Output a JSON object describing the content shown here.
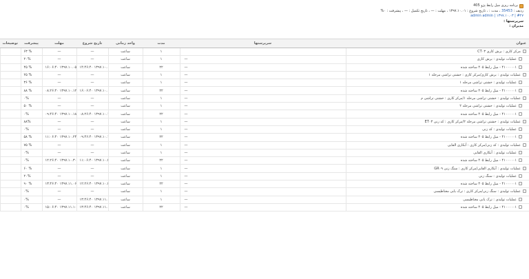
{
  "header": {
    "title": "برنامه ریزی میل رابط پژو 405",
    "meta_prefix": "ردیف :",
    "meta_id": "35453",
    "meta_rest": "، مدت : ، تاریخ شروع : ۱۳۹۷.۱۰.۰۱ ، مهلت : — ، تاریخ تکمیل : — ، پیشرفت : ۰%",
    "meta_line2": "#۲۷ | ۱۳۹۷.۱۰.۰۳ | admin admin",
    "supervisors_label": "سرپرستها :",
    "managers_label": "مدیران :"
  },
  "columns": {
    "title": "عنوان",
    "supervisors": "سرپرستها",
    "duration": "مدت",
    "unit": "واحد زمانی",
    "start": "تاریخ شروع",
    "deadline": "مهلت",
    "progress": "پیشرفت",
    "notes": "توضیحات"
  },
  "rows": [
    {
      "title": "مرکز کاری : برش کاری CT۰۳",
      "res": "",
      "dur": "۱",
      "unit": "ساعت",
      "start": "—",
      "deadline": "—",
      "prog": "۶۳ %",
      "level": 1
    },
    {
      "title": "عملیات تولیدی : برش کاری",
      "res": "—",
      "dur": "۱",
      "unit": "ساعت",
      "start": "—",
      "deadline": "—",
      "prog": "۲۰%",
      "level": 2
    },
    {
      "title": "۴۱۰۰۰۰۰۱ - میل رابط ۴۰۵ ساخته شده",
      "res": "—",
      "dur": "۲۲",
      "unit": "ساعت",
      "start": "۱۴:۴۶:۴۰ ۱۳۹۷.۱۰.۰۱",
      "deadline": "۱۶:۰۶:۴۰ ۱۳۹۷.۱۰.۰۵",
      "prog": "۴۵ %",
      "level": 2
    },
    {
      "title": "عملیات تولیدی : برش کاری/مرکز کاری : خشتی تراشی مرحله ۱",
      "res": "—",
      "dur": "۱",
      "unit": "ساعت",
      "start": "—",
      "deadline": "—",
      "prog": "۲۵ %",
      "level": 1
    },
    {
      "title": "عملیات تولیدی : خشتی تراشی مرحله ۱",
      "res": "—",
      "dur": "۱",
      "unit": "ساعت",
      "start": "—",
      "deadline": "—",
      "prog": "۳۶ %",
      "level": 2
    },
    {
      "title": "۴۱۰۰۰۰۰۱ - میل رابط ۴۰۵ ساخته شده",
      "res": "—",
      "dur": "۲۲",
      "unit": "ساعت",
      "start": "۱۶:۰۶:۴۰ ۱۳۹۷.۱۰.۰۵",
      "deadline": "۰۸:۲۶:۴۰ ۱۳۹۷.۱۰.۱۲",
      "prog": "۸۸ %",
      "level": 2
    },
    {
      "title": "عملیات تولیدی : خشتی تراشی مرحله ۱/مرکز کاری : خشتی تراشی م",
      "res": "—",
      "dur": "۱",
      "unit": "ساعت",
      "start": "—",
      "deadline": "—",
      "prog": "۰%",
      "level": 1
    },
    {
      "title": "عملیات تولیدی : خشتی تراشی مرحله ۲",
      "res": "—",
      "dur": "۱",
      "unit": "ساعت",
      "start": "—",
      "deadline": "—",
      "prog": "۵۰ %",
      "level": 2
    },
    {
      "title": "۴۱۰۰۰۰۰۱ - میل رابط ۴۰۵ ساخته شده",
      "res": "—",
      "dur": "۲۲",
      "unit": "ساعت",
      "start": "۰۸:۲۶:۴۰ ۱۳۹۷.۱۰.۱۲",
      "deadline": "۰۹:۴۶:۴۰ ۱۳۹۷.۱۰.۱۸",
      "prog": "۰%",
      "level": 2
    },
    {
      "title": "عملیات تولیدی : خشتی تراشی مرحله ۲/مرکز کاری : کد زنی ET۰۳",
      "res": "—",
      "dur": "۱",
      "unit": "ساعت",
      "start": "—",
      "deadline": "—",
      "prog": "۸۸%",
      "level": 1
    },
    {
      "title": "عملیات تولیدی : کد زنی",
      "res": "—",
      "dur": "۱",
      "unit": "ساعت",
      "start": "—",
      "deadline": "—",
      "prog": "۰%",
      "level": 2
    },
    {
      "title": "۴۱۰۰۰۰۰۱ - میل رابط ۴۰۵ ساخته شده",
      "res": "—",
      "dur": "۲۲",
      "unit": "ساعت",
      "start": "۰۹:۴۶:۴۰ ۱۳۹۷.۱۰.۱۸",
      "deadline": "۱۱:۰۶:۴۰ ۱۳۹۷.۱۰.۲۴",
      "prog": "۵۸ %",
      "level": 2
    },
    {
      "title": "عملیات تولیدی : کد زنی/مرکز کاری : آبکاری القایی",
      "res": "—",
      "dur": "۱",
      "unit": "ساعت",
      "start": "—",
      "deadline": "—",
      "prog": "۷۵ %",
      "level": 1
    },
    {
      "title": "عملیات تولیدی : آبکاری القایی",
      "res": "—",
      "dur": "۱",
      "unit": "ساعت",
      "start": "—",
      "deadline": "—",
      "prog": "۰%",
      "level": 2
    },
    {
      "title": "۴۱۰۰۰۰۰۱ - میل رابط ۴۰۵ ساخته شده",
      "res": "—",
      "dur": "۲۲",
      "unit": "ساعت",
      "start": "۱۱:۰۶:۴۰ ۱۳۹۷.۱۰.۲۴",
      "deadline": "۱۲:۲۶:۴۰ ۱۳۹۷.۱۰.۳۰",
      "prog": "۰%",
      "level": 2
    },
    {
      "title": "عملیات تولیدی : آبکاری القایی/مرکز کاری : سنگ زنی GR۰۹",
      "res": "—",
      "dur": "۱",
      "unit": "ساعت",
      "start": "—",
      "deadline": "—",
      "prog": "۶۰ %",
      "level": 1
    },
    {
      "title": "عملیات تولیدی : سنگ زنی",
      "res": "—",
      "dur": "۱",
      "unit": "ساعت",
      "start": "—",
      "deadline": "—",
      "prog": "۲۰%",
      "level": 2
    },
    {
      "title": "۴۱۰۰۰۰۰۱ - میل رابط ۴۰۵ ساخته شده",
      "res": "—",
      "dur": "۲۲",
      "unit": "ساعت",
      "start": "۱۲:۲۶:۴۰ ۱۳۹۷.۱۰.۳۰",
      "deadline": "۱۳:۴۶:۴۰ ۱۳۹۷.۱۱.۰۶",
      "prog": "۹۰ %",
      "level": 2
    },
    {
      "title": "عملیات تولیدی : سنگ زنی/مرکز کاری : ترک یابی مغناطیسی",
      "res": "—",
      "dur": "۱",
      "unit": "ساعت",
      "start": "—",
      "deadline": "—",
      "prog": "۰%",
      "level": 1
    },
    {
      "title": "عملیات تولیدی : ترک یابی مغناطیسی",
      "res": "—",
      "dur": "۱",
      "unit": "ساعت",
      "start": "۱۳:۴۶:۴۰ ۱۳۹۷.۱۱.۰۶",
      "deadline": "—",
      "prog": "۰%",
      "level": 2
    },
    {
      "title": "۴۱۰۰۰۰۰۱ - میل رابط ۴۰۵ ساخته شده",
      "res": "—",
      "dur": "۲۲",
      "unit": "ساعت",
      "start": "۱۳:۴۶:۴۰ ۱۳۹۷.۱۱.۰۶",
      "deadline": "۱۵:۰۶:۴۰ ۱۳۹۷.۱۱.۱۰",
      "prog": "۰%",
      "level": 2
    }
  ]
}
